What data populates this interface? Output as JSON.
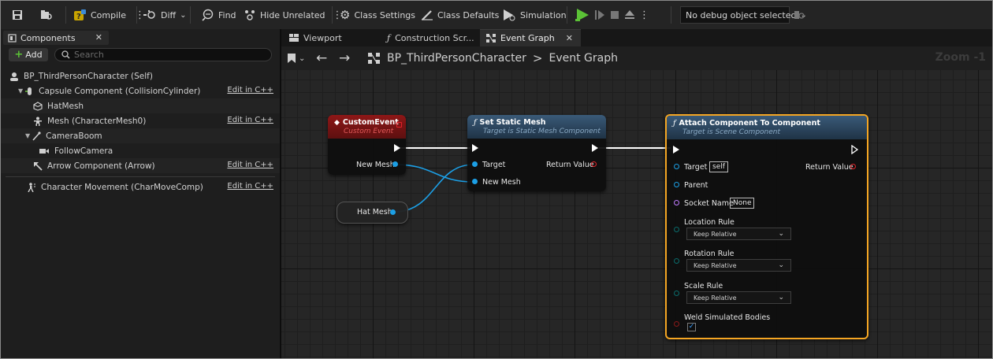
{
  "toolbar": {
    "compile_label": "Compile",
    "diff_label": "Diff",
    "find_label": "Find",
    "hide_unrelated_label": "Hide Unrelated",
    "class_settings_label": "Class Settings",
    "class_defaults_label": "Class Defaults",
    "simulation_label": "Simulation",
    "debug_object": "No debug object selected"
  },
  "components_panel": {
    "tab_label": "Components",
    "add_label": "Add",
    "search_placeholder": "Search",
    "items": [
      {
        "label": "BP_ThirdPersonCharacter (Self)",
        "edit": ""
      },
      {
        "label": "Capsule Component (CollisionCylinder)",
        "edit": "Edit in C++"
      },
      {
        "label": "HatMesh",
        "edit": ""
      },
      {
        "label": "Mesh (CharacterMesh0)",
        "edit": "Edit in C++"
      },
      {
        "label": "CameraBoom",
        "edit": ""
      },
      {
        "label": "FollowCamera",
        "edit": ""
      },
      {
        "label": "Arrow Component (Arrow)",
        "edit": "Edit in C++"
      },
      {
        "label": "Character Movement (CharMoveComp)",
        "edit": "Edit in C++"
      }
    ]
  },
  "editor_tabs": [
    {
      "label": "Viewport"
    },
    {
      "label": "Construction Scr..."
    },
    {
      "label": "Event Graph"
    }
  ],
  "breadcrumb": {
    "blueprint": "BP_ThirdPersonCharacter",
    "separator": ">",
    "graph": "Event Graph",
    "zoom": "Zoom -1"
  },
  "nodes": {
    "custom_event": {
      "title": "CustomEvent",
      "subtitle": "Custom Event",
      "pin_new_mesh": "New Mesh"
    },
    "hat_mesh": {
      "label": "Hat Mesh"
    },
    "set_static_mesh": {
      "title": "Set Static Mesh",
      "subtitle": "Target is Static Mesh Component",
      "pin_target": "Target",
      "pin_new_mesh": "New Mesh",
      "pin_return": "Return Value"
    },
    "attach": {
      "title": "Attach Component To Component",
      "subtitle": "Target is Scene Component",
      "pin_target": "Target",
      "target_value": "self",
      "pin_return": "Return Value",
      "pin_parent": "Parent",
      "pin_socket": "Socket Name",
      "socket_value": "None",
      "location_rule": "Location Rule",
      "location_value": "Keep Relative",
      "rotation_rule": "Rotation Rule",
      "rotation_value": "Keep Relative",
      "scale_rule": "Scale Rule",
      "scale_value": "Keep Relative",
      "weld": "Weld Simulated Bodies",
      "weld_checked": true
    }
  },
  "colors": {
    "event_header": "#8e1717",
    "function_header": "#3a5a78",
    "object_pin": "#1c9fe5",
    "return_pin": "#e0232a",
    "name_pin": "#c07cff",
    "enum_pin": "#0a6b6b",
    "selection": "#f5a623",
    "play_green": "#5bc236"
  }
}
